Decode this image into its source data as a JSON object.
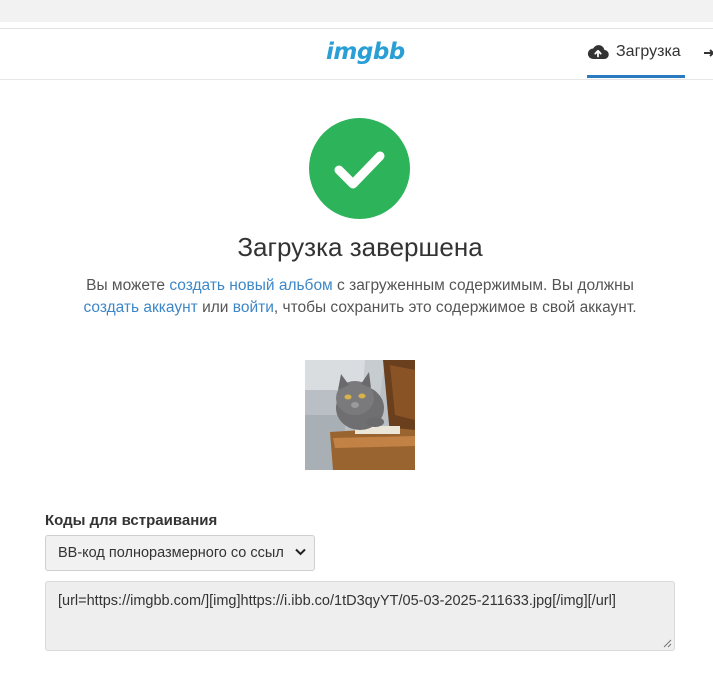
{
  "header": {
    "logo": "imgbb",
    "upload_tab_label": "Загрузка",
    "accent": "#2a9fd6"
  },
  "status": {
    "title": "Загрузка завершена",
    "color": "#2db35a",
    "description": {
      "part1": "Вы можете ",
      "link_album": "создать новый альбом",
      "part2": " с загруженным содержимым. Вы должны",
      "link_account": "создать аккаунт",
      "part3": " или ",
      "link_login": "войти",
      "part4": ", чтобы сохранить это содержимое в свой аккаунт."
    }
  },
  "embed": {
    "label": "Коды для встраивания",
    "select_value": "BB-код полноразмерного со ссыл",
    "code": "[url=https://imgbb.com/][img]https://i.ibb.co/1tD3qyYT/05-03-2025-211633.jpg[/img][/url]"
  },
  "icons": {
    "upload": "cloud-upload-icon",
    "check": "check-icon",
    "chevron": "chevron-down-icon"
  }
}
